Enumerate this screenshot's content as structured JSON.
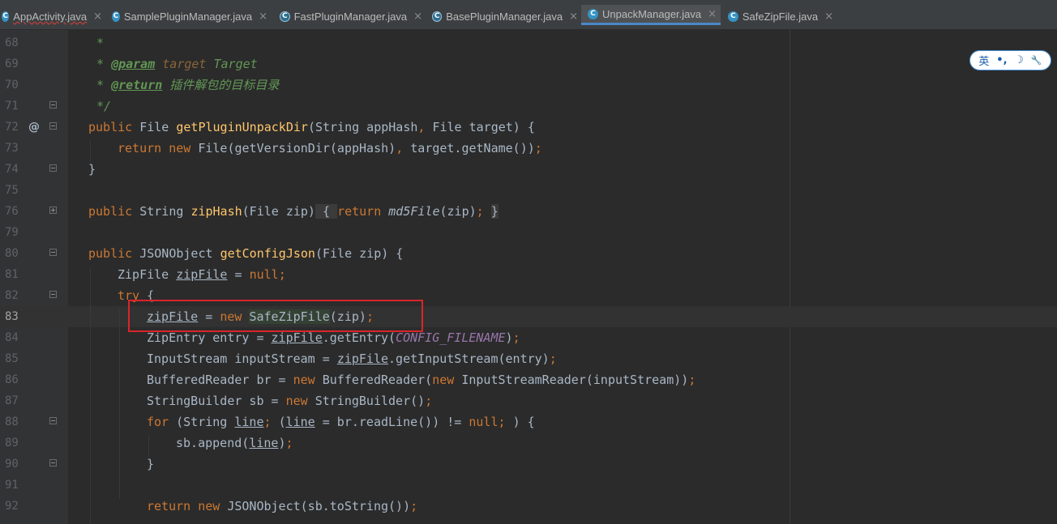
{
  "tabs": [
    {
      "label": "AppActivity.java",
      "icon": "class-icon",
      "active": false
    },
    {
      "label": "SamplePluginManager.java",
      "icon": "class-icon",
      "active": false
    },
    {
      "label": "FastPluginManager.java",
      "icon": "abstract-class-icon",
      "active": false
    },
    {
      "label": "BasePluginManager.java",
      "icon": "abstract-class-icon",
      "active": false
    },
    {
      "label": "UnpackManager.java",
      "icon": "class-icon",
      "active": true
    },
    {
      "label": "SafeZipFile.java",
      "icon": "class-icon",
      "active": false
    }
  ],
  "close_glyph": "×",
  "ime_toolbar": {
    "lang": "英",
    "punct": "•,",
    "mode": "☽",
    "tool": "🔧"
  },
  "gutter_mark": "@",
  "line_numbers": [
    "68",
    "69",
    "70",
    "71",
    "72",
    "73",
    "74",
    "75",
    "76",
    "79",
    "80",
    "81",
    "82",
    "83",
    "84",
    "85",
    "86",
    "87",
    "88",
    "89",
    "90",
    "91",
    "92"
  ],
  "code": {
    "l68": "*",
    "l69_star": "* ",
    "l69_tag": "@param",
    "l69_sp": " ",
    "l69_name": "target",
    "l69_rest": " Target",
    "l70_star": "* ",
    "l70_tag": "@return",
    "l70_rest": " 插件解包的目标目录",
    "l71": "*/",
    "l72_kw": "public ",
    "l72_type": "File ",
    "l72_fn": "getPluginUnpackDir",
    "l72_rest1": "(String appHash",
    "l72_comma": ",",
    "l72_rest2": " File target) {",
    "l73_kw1": "return ",
    "l73_kw2": "new ",
    "l73_rest1": "File(getVersionDir(appHash)",
    "l73_comma": ",",
    "l73_rest2": " target.getName())",
    "l73_semi": ";",
    "l74": "}",
    "l76_kw": "public ",
    "l76_type": "String ",
    "l76_fn": "zipHash",
    "l76_args": "(File zip)",
    "l76_ob": " { ",
    "l76_ret": "return ",
    "l76_call": "md5File",
    "l76_zip": "(zip)",
    "l76_semi": "; ",
    "l76_cb": "}",
    "l80_kw": "public ",
    "l80_type": "JSONObject ",
    "l80_fn": "getConfigJson",
    "l80_rest": "(File zip) {",
    "l81_type": "ZipFile ",
    "l81_var": "zipFile",
    "l81_eq": " = ",
    "l81_null": "null",
    "l81_semi": ";",
    "l82_try": "try",
    "l82_ob": " {",
    "l83_var": "zipFile",
    "l83_eq": " = ",
    "l83_new": "new ",
    "l83_cls": "SafeZipFile",
    "l83_args": "(zip)",
    "l83_semi": ";",
    "l84_a": "ZipEntry entry = ",
    "l84_var": "zipFile",
    "l84_b": ".getEntry(",
    "l84_const": "CONFIG_FILENAME",
    "l84_c": ")",
    "l84_semi": ";",
    "l85_a": "InputStream inputStream = ",
    "l85_var": "zipFile",
    "l85_b": ".getInputStream(entry)",
    "l85_semi": ";",
    "l86_a": "BufferedReader br = ",
    "l86_new1": "new ",
    "l86_b": "BufferedReader(",
    "l86_new2": "new ",
    "l86_c": "InputStreamReader(inputStream))",
    "l86_semi": ";",
    "l87_a": "StringBuilder sb = ",
    "l87_new": "new ",
    "l87_b": "StringBuilder()",
    "l87_semi": ";",
    "l88_for": "for ",
    "l88_a": "(String ",
    "l88_var1": "line",
    "l88_semi1": "; ",
    "l88_b": "(",
    "l88_var2": "line",
    "l88_c": " = br.readLine()) != ",
    "l88_null": "null",
    "l88_semi2": "; ",
    "l88_d": ") {",
    "l89_a": "sb.append(",
    "l89_var": "line",
    "l89_b": ")",
    "l89_semi": ";",
    "l90": "}",
    "l92_ret": "return ",
    "l92_new": "new ",
    "l92_a": "JSONObject(sb.toString())",
    "l92_semi": ";"
  }
}
